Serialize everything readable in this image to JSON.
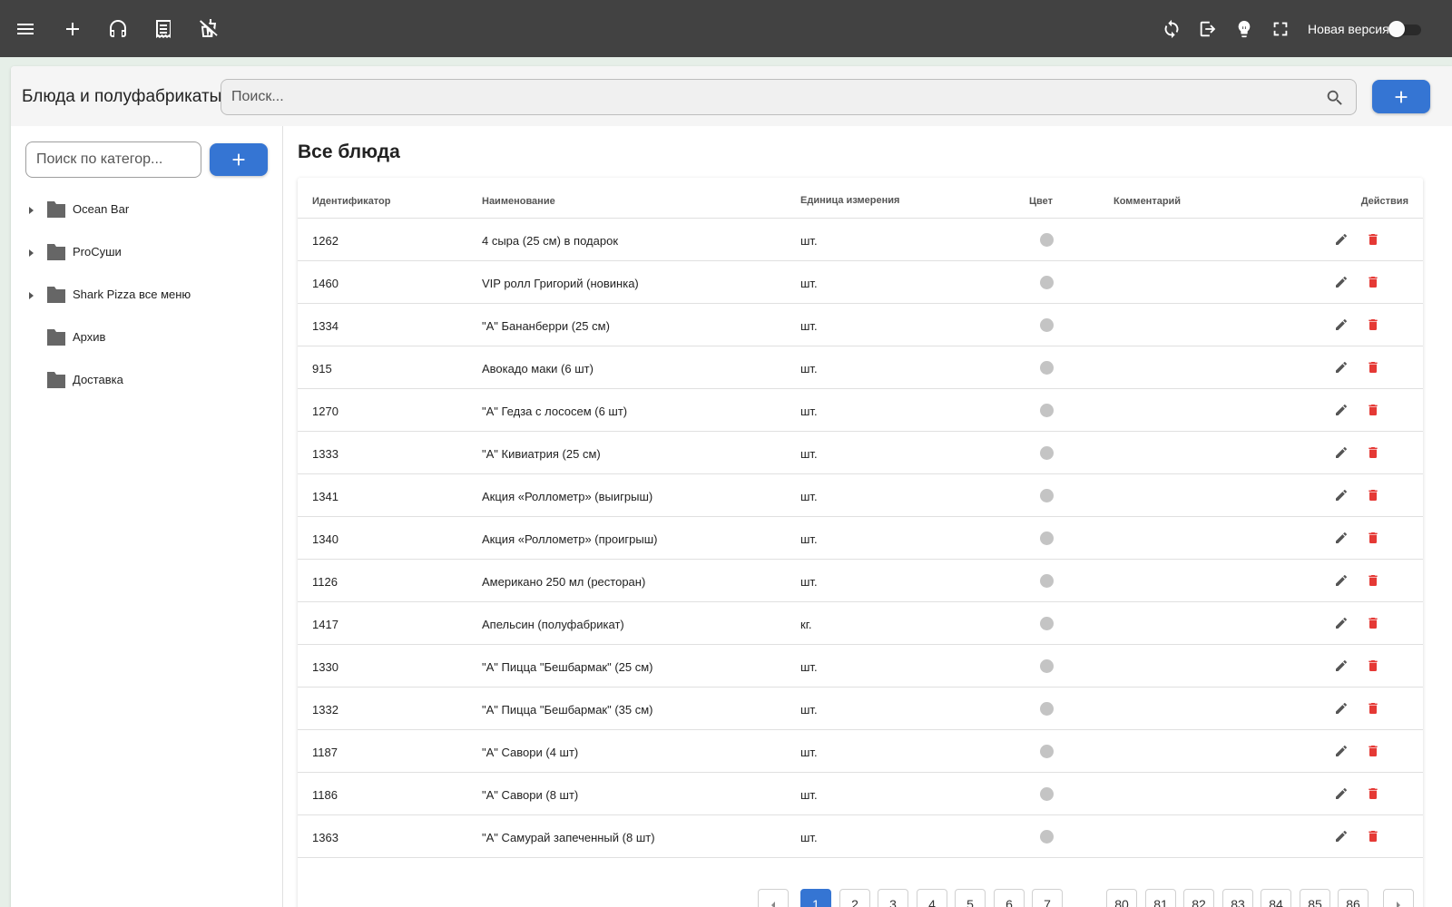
{
  "topbar": {
    "new_version_label": "Новая версия",
    "new_version_enabled": false,
    "left_icons": [
      "menu-icon",
      "plus-icon",
      "headset-icon",
      "receipt-icon",
      "no-food-icon"
    ],
    "right_icons": [
      "sync-icon",
      "logout-icon",
      "theme-icon",
      "fullscreen-icon"
    ]
  },
  "header": {
    "title": "Блюда и полуфабрикаты",
    "search_placeholder": "Поиск..."
  },
  "sidebar": {
    "search_placeholder": "Поиск по категор...",
    "categories": [
      {
        "label": "Ocean Bar",
        "expandable": true
      },
      {
        "label": "ProСуши",
        "expandable": true
      },
      {
        "label": "Shark Pizza все меню",
        "expandable": true
      },
      {
        "label": "Архив",
        "expandable": false
      },
      {
        "label": "Доставка",
        "expandable": false
      }
    ]
  },
  "main": {
    "title": "Все блюда",
    "columns": {
      "id": "Идентификатор",
      "name": "Наименование",
      "unit": "Единица измерения",
      "color": "Цвет",
      "comment": "Комментарий",
      "actions": "Действия"
    },
    "rows": [
      {
        "id": "1262",
        "name": "4 сыра (25 см) в подарок",
        "unit": "шт.",
        "color": "#c4c4c4",
        "comment": ""
      },
      {
        "id": "1460",
        "name": "VIP ролл Григорий (новинка)",
        "unit": "шт.",
        "color": "#c4c4c4",
        "comment": ""
      },
      {
        "id": "1334",
        "name": "\"А\" Бананберри (25 см)",
        "unit": "шт.",
        "color": "#c4c4c4",
        "comment": ""
      },
      {
        "id": "915",
        "name": "Авокадо маки (6 шт)",
        "unit": "шт.",
        "color": "#c4c4c4",
        "comment": ""
      },
      {
        "id": "1270",
        "name": "\"А\" Гедза с лососем (6 шт)",
        "unit": "шт.",
        "color": "#c4c4c4",
        "comment": ""
      },
      {
        "id": "1333",
        "name": "\"А\" Кивиатрия (25 см)",
        "unit": "шт.",
        "color": "#c4c4c4",
        "comment": ""
      },
      {
        "id": "1341",
        "name": "Акция «Роллометр» (выигрыш)",
        "unit": "шт.",
        "color": "#c4c4c4",
        "comment": ""
      },
      {
        "id": "1340",
        "name": "Акция «Роллометр» (проигрыш)",
        "unit": "шт.",
        "color": "#c4c4c4",
        "comment": ""
      },
      {
        "id": "1126",
        "name": "Американо 250 мл (ресторан)",
        "unit": "шт.",
        "color": "#c4c4c4",
        "comment": ""
      },
      {
        "id": "1417",
        "name": "Апельсин (полуфабрикат)",
        "unit": "кг.",
        "color": "#c4c4c4",
        "comment": ""
      },
      {
        "id": "1330",
        "name": "\"А\" Пицца \"Бешбармак\" (25 см)",
        "unit": "шт.",
        "color": "#c4c4c4",
        "comment": ""
      },
      {
        "id": "1332",
        "name": "\"А\" Пицца \"Бешбармак\" (35 см)",
        "unit": "шт.",
        "color": "#c4c4c4",
        "comment": ""
      },
      {
        "id": "1187",
        "name": "\"А\" Савори (4 шт)",
        "unit": "шт.",
        "color": "#c4c4c4",
        "comment": ""
      },
      {
        "id": "1186",
        "name": "\"А\" Савори (8 шт)",
        "unit": "шт.",
        "color": "#c4c4c4",
        "comment": ""
      },
      {
        "id": "1363",
        "name": "\"А\" Самурай запеченный (8 шт)",
        "unit": "шт.",
        "color": "#c4c4c4",
        "comment": ""
      }
    ],
    "pagination": {
      "current": "1",
      "pages_start": [
        "1",
        "2",
        "3",
        "4",
        "5",
        "6",
        "7"
      ],
      "pages_end": [
        "80",
        "81",
        "82",
        "83",
        "84",
        "85",
        "86"
      ]
    }
  },
  "colors": {
    "topbar_bg": "#424242",
    "accent": "#3575d3",
    "delete": "#e53935",
    "page_bg": "#e6efe8"
  }
}
